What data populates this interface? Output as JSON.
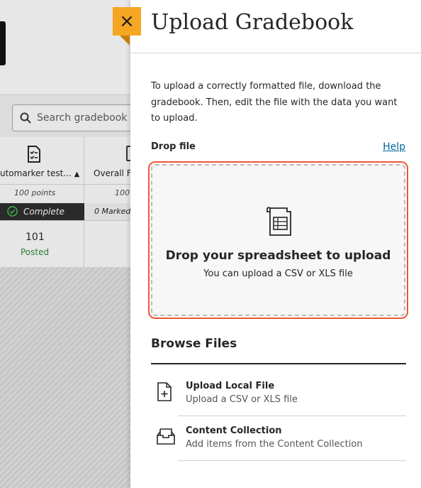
{
  "background": {
    "search_placeholder": "Search gradebook",
    "columns": [
      {
        "name": "utomarker test...",
        "points": "100 points",
        "status": "Complete",
        "score": "101",
        "score_status": "Posted"
      },
      {
        "name": "Overall F",
        "points": "100",
        "status": "0 Marked"
      }
    ]
  },
  "panel": {
    "close_label": "×",
    "title": "Upload Gradebook",
    "intro": "To upload a correctly formatted file, download the gradebook. Then, edit the file with the data you want to upload.",
    "drop_label": "Drop file",
    "help_label": "Help",
    "dropzone": {
      "title": "Drop your spreadsheet to upload",
      "subtitle": "You can upload a CSV or XLS file",
      "icon": "spreadsheet-icon"
    },
    "browse_title": "Browse Files",
    "options": [
      {
        "title": "Upload Local File",
        "subtitle": "Upload a CSV or XLS file",
        "icon": "file-add-icon"
      },
      {
        "title": "Content Collection",
        "subtitle": "Add items from the Content Collection",
        "icon": "inbox-tray-icon"
      }
    ]
  },
  "colors": {
    "accent_close": "#f5a623",
    "dropzone_border": "#e8583a",
    "link": "#006599",
    "posted_green": "#2e7d32"
  }
}
